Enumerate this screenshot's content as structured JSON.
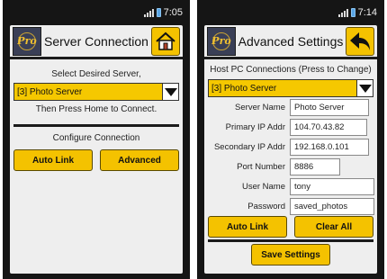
{
  "left": {
    "status": {
      "time": "7:05"
    },
    "title": "Server Connection",
    "logo_text": "Pro",
    "select_prompt": "Select Desired Server,",
    "server_dropdown": {
      "selected": "[3]  Photo Server"
    },
    "press_home_text": "Then Press Home to Connect.",
    "configure_text": "Configure Connection",
    "buttons": {
      "auto_link": "Auto Link",
      "advanced": "Advanced"
    },
    "icons": {
      "nav": "home-icon",
      "logo": "pro-logo-icon"
    },
    "accent_color": "#f4c200"
  },
  "right": {
    "status": {
      "time": "7:14"
    },
    "title": "Advanced Settings",
    "logo_text": "Pro",
    "host_prompt": "Host PC Connections (Press to Change)",
    "server_dropdown": {
      "selected": "[3]  Photo Server"
    },
    "fields": {
      "server_name": {
        "label": "Server Name",
        "value": "Photo Server"
      },
      "primary_ip": {
        "label": "Primary IP Addr",
        "value": "104.70.43.82"
      },
      "secondary_ip": {
        "label": "Secondary IP Addr",
        "value": "192.168.0.101"
      },
      "port": {
        "label": "Port Number",
        "value": "8886"
      },
      "user_name": {
        "label": "User Name",
        "value": "tony"
      },
      "password": {
        "label": "Password",
        "value": "saved_photos"
      }
    },
    "buttons": {
      "auto_link": "Auto Link",
      "clear_all": "Clear All",
      "save": "Save Settings"
    },
    "icons": {
      "nav": "back-arrow-icon",
      "logo": "pro-logo-icon"
    },
    "accent_color": "#f4c200"
  }
}
